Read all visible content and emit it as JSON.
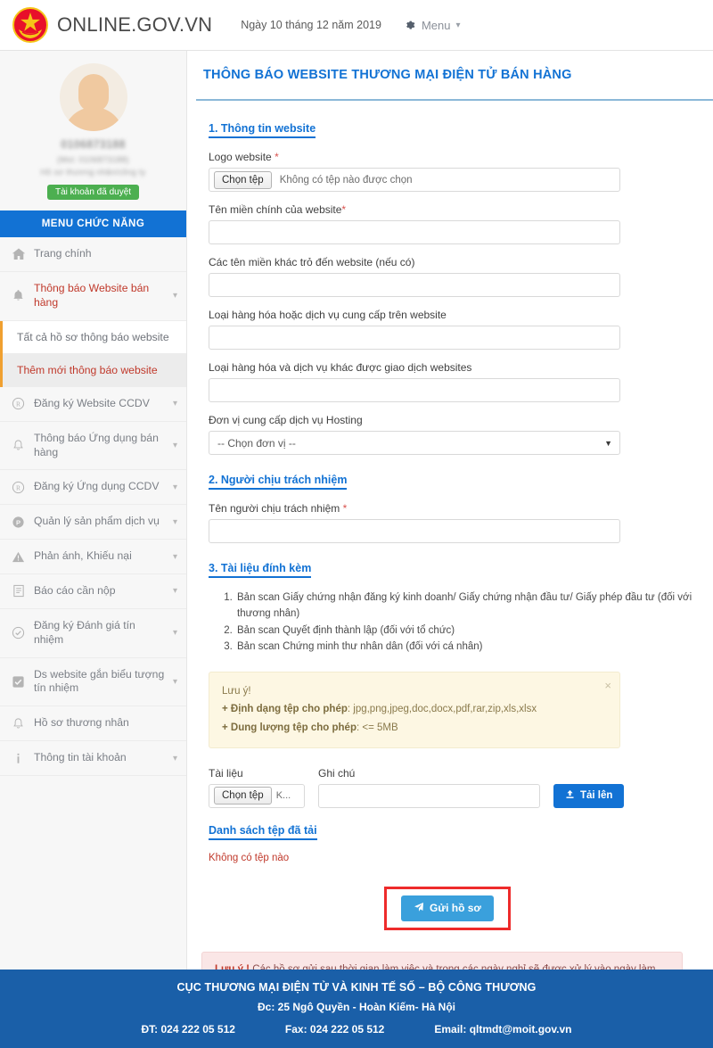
{
  "header": {
    "brand": "ONLINE.GOV.VN",
    "date": "Ngày 10 tháng 12 năm 2019",
    "menu_label": "Menu",
    "emblem_icon": "vietnam-emblem-icon",
    "gear_icon": "gear-icon",
    "chevron_icon": "chevron-down-icon"
  },
  "sidebar": {
    "profile": {
      "tax_code": "0106873188",
      "line2": "(Mst: 0106873188)",
      "line3": "Hồ sơ thương nhân/công ty",
      "badge": "Tài khoản đã duyệt"
    },
    "menu_title": "MENU CHỨC NĂNG",
    "items": [
      {
        "label": "Trang chính",
        "icon": "home-icon",
        "expandable": false,
        "active": false
      },
      {
        "label": "Thông báo Website bán hàng",
        "icon": "bell-icon",
        "expandable": true,
        "active": true
      }
    ],
    "submenu": [
      {
        "label": "Tất cả hồ sơ thông báo website",
        "current": false
      },
      {
        "label": "Thêm mới thông báo website",
        "current": true
      }
    ],
    "items_after": [
      {
        "label": "Đăng ký Website CCDV",
        "icon": "registered-icon",
        "expandable": true
      },
      {
        "label": "Thông báo Ứng dụng bán hàng",
        "icon": "bell-icon",
        "expandable": true
      },
      {
        "label": "Đăng ký Ứng dụng CCDV",
        "icon": "registered-icon",
        "expandable": true
      },
      {
        "label": "Quản lý sản phẩm dịch vụ",
        "icon": "p-circle-icon",
        "expandable": true
      },
      {
        "label": "Phản ánh, Khiếu nại",
        "icon": "warning-triangle-icon",
        "expandable": true
      },
      {
        "label": "Báo cáo cần nộp",
        "icon": "document-icon",
        "expandable": true
      },
      {
        "label": "Đăng ký Đánh giá tín nhiệm",
        "icon": "check-circle-icon",
        "expandable": true
      },
      {
        "label": "Ds website gắn biểu tượng tín nhiệm",
        "icon": "checkbox-icon",
        "expandable": true
      },
      {
        "label": "Hồ sơ thương nhân",
        "icon": "bell-icon",
        "expandable": false
      },
      {
        "label": "Thông tin tài khoản",
        "icon": "info-icon",
        "expandable": true
      }
    ]
  },
  "main": {
    "page_title": "THÔNG BÁO WEBSITE THƯƠNG MẠI ĐIỆN TỬ BÁN HÀNG",
    "section1": {
      "heading": "1. Thông tin website",
      "logo_label": "Logo website",
      "logo_required": "*",
      "file_button": "Chọn tệp",
      "file_status": "Không có tệp nào được chọn",
      "domain_label": "Tên miền chính của website",
      "domain_required": "*",
      "domain_value": "",
      "other_domains_label": "Các tên miền khác trỏ đến website (nếu có)",
      "other_domains_value": "",
      "goods_label": "Loại hàng hóa hoặc dịch vụ cung cấp trên website",
      "goods_value": "",
      "other_goods_label": "Loại hàng hóa và dịch vụ khác được giao dịch websites",
      "other_goods_value": "",
      "hosting_label": "Đơn vị cung cấp dịch vụ Hosting",
      "hosting_selected": "-- Chọn đơn vị --"
    },
    "section2": {
      "heading": "2. Người chịu trách nhiệm",
      "name_label": "Tên người chịu trách nhiệm",
      "name_required": "*",
      "name_value": ""
    },
    "section3": {
      "heading": "3. Tài liệu đính kèm",
      "documents": [
        "Bản scan Giấy chứng nhận đăng ký kinh doanh/ Giấy chứng nhận đầu tư/ Giấy phép đầu tư (đối với thương nhân)",
        "Bản scan Quyết định thành lập (đối với tổ chức)",
        "Bản scan Chứng minh thư nhân dân (đối với cá nhân)"
      ],
      "notice_title": "Lưu ý!",
      "notice_line1_label": "+ Định dạng tệp cho phép",
      "notice_line1_value": ": jpg,png,jpeg,doc,docx,pdf,rar,zip,xls,xlsx",
      "notice_line2_label": "+ Dung lượng tệp cho phép",
      "notice_line2_value": ": <= 5MB",
      "notice_close_icon": "close-icon",
      "doc_label": "Tài liệu",
      "doc_file_button": "Chọn tệp",
      "doc_file_status": "K...",
      "note_label": "Ghi chú",
      "note_value": "",
      "upload_button": "Tải lên",
      "upload_icon": "upload-icon",
      "file_list_link": "Danh sách tệp đã tải",
      "no_files": "Không có tệp nào"
    },
    "submit": {
      "label": "Gửi hồ sơ",
      "icon": "send-icon",
      "highlight_color": "#ee2b2b"
    },
    "bottom_notice_bold": "Lưu ý !",
    "bottom_notice_text": " Các hồ sơ gửi sau thời gian làm việc và trong các ngày nghỉ sẽ được xử lý vào ngày làm việc tiếp theo."
  },
  "footer": {
    "line1": "CỤC THƯƠNG MẠI ĐIỆN TỬ VÀ KINH TẾ SỐ – BỘ CÔNG THƯƠNG",
    "line2": "Đc: 25 Ngô Quyền - Hoàn Kiếm- Hà Nội",
    "phone": "ĐT: 024 222 05 512",
    "fax": "Fax: 024 222 05 512",
    "email": "Email: qltmdt@moit.gov.vn"
  },
  "colors": {
    "primary_blue": "#1272d4",
    "footer_blue": "#1a5fa8",
    "accent_orange": "#f0a030",
    "active_red": "#c0392b",
    "badge_green": "#4caf50",
    "submit_blue": "#3aa0dc"
  }
}
